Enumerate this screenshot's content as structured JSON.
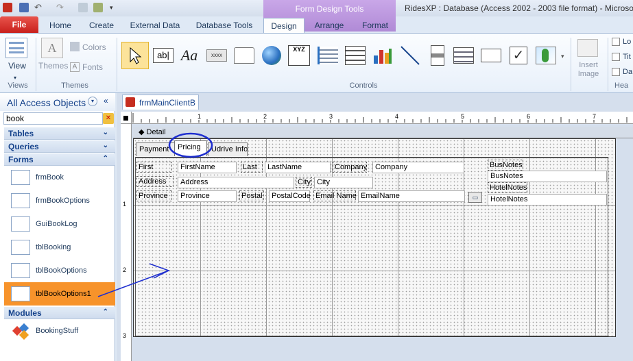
{
  "window": {
    "context_tab_group": "Form Design Tools",
    "title": "RidesXP : Database (Access 2002 - 2003 file format) - Microsoft"
  },
  "ribbon_tabs": [
    "File",
    "Home",
    "Create",
    "External Data",
    "Database Tools",
    "Design",
    "Arrange",
    "Format"
  ],
  "active_tab": "Design",
  "ribbon": {
    "views": {
      "label": "View",
      "group": "Views"
    },
    "themes": {
      "themes_label": "Themes",
      "colors_label": "Colors",
      "fonts_label": "Fonts",
      "group": "Themes"
    },
    "controls_group": "Controls",
    "insert_image": "Insert Image",
    "header_footer_items": [
      "Lo",
      "Tit",
      "Da"
    ],
    "header_group": "Hea",
    "controls": [
      "select-icon",
      "textbox-icon",
      "label-icon",
      "button-icon",
      "tab-control-icon",
      "hyperlink-icon",
      "navigation-icon",
      "option-group-icon",
      "page-break-icon",
      "combo-box-icon",
      "chart-icon",
      "line-icon",
      "toggle-button-icon",
      "listbox-icon",
      "rectangle-icon",
      "checkbox-icon",
      "unbound-object-icon"
    ]
  },
  "nav": {
    "header": "All Access Objects",
    "search_value": "book",
    "groups": {
      "tables": "Tables",
      "queries": "Queries",
      "forms": "Forms",
      "modules": "Modules"
    },
    "forms": [
      "frmBook",
      "frmBookOptions",
      "GuiBookLog",
      "tblBooking",
      "tblBookOptions",
      "tblBookOptions1"
    ],
    "modules": [
      "BookingStuff"
    ],
    "selected": "tblBookOptions1"
  },
  "document": {
    "tab_title": "frmMainClientB",
    "section": "Detail",
    "ruler_numbers": [
      "1",
      "2",
      "3",
      "4",
      "5",
      "6",
      "7"
    ],
    "vruler_numbers": [
      "1",
      "2",
      "3"
    ],
    "page_tabs": [
      "Payment",
      "Pricing",
      "Udrive Info"
    ],
    "active_page_tab": "Pricing",
    "labels": {
      "first": "First",
      "last": "Last",
      "company": "Company",
      "address": "Address",
      "city": "City",
      "province": "Province",
      "postal": "Postal",
      "email": "Email Name",
      "busnotes": "BusNotes",
      "hotelnotes": "HotelNotes"
    },
    "fields": {
      "firstname": "FirstName",
      "lastname": "LastName",
      "company": "Company",
      "address": "Address",
      "city": "City",
      "province": "Province",
      "postalcode": "PostalCode",
      "emailname": "EmailName",
      "busnotes": "BusNotes",
      "hotelnotes": "HotelNotes"
    }
  },
  "annotation_color": "#1f2fd0",
  "accent_color": "#f7932b"
}
